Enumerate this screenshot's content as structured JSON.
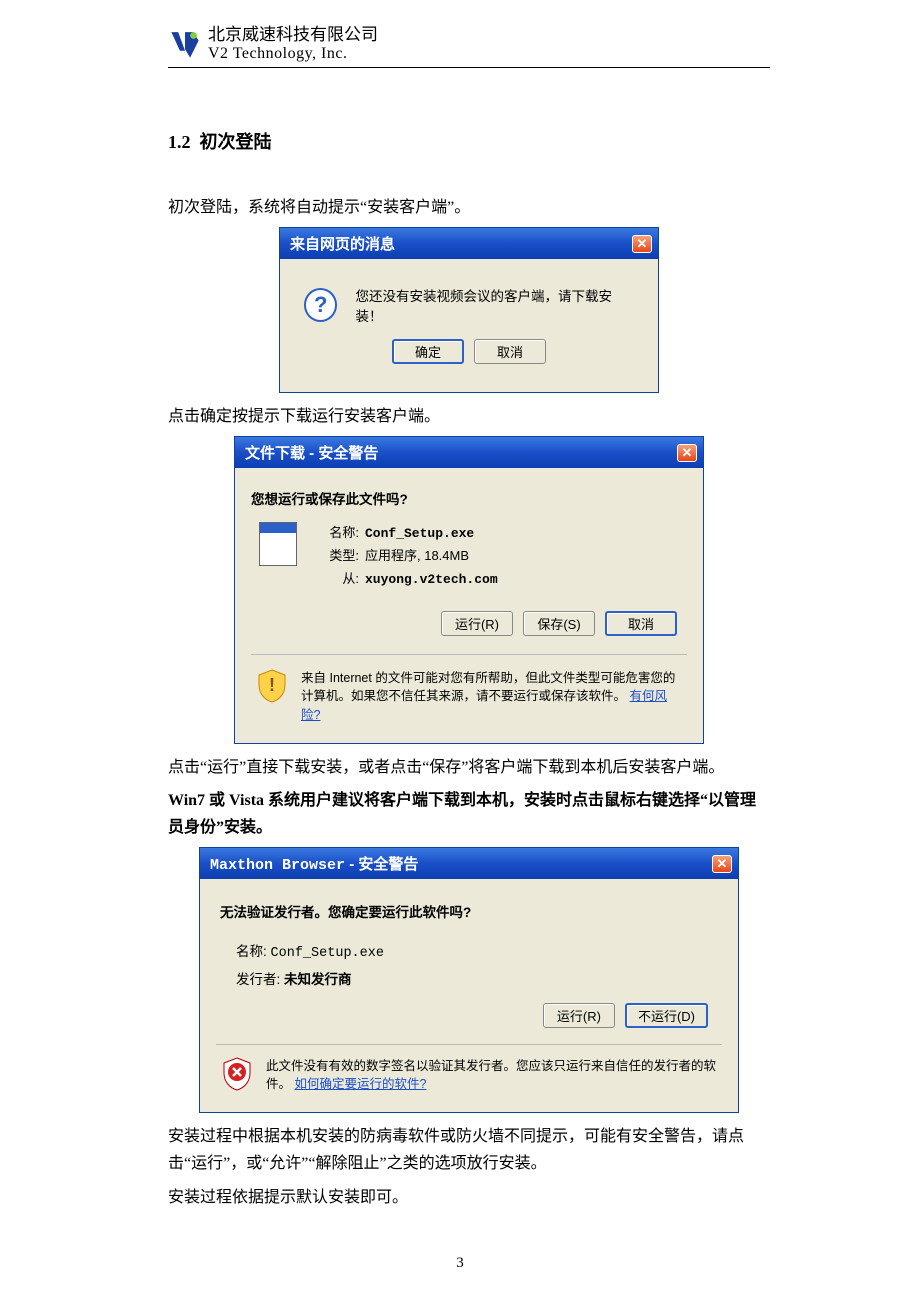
{
  "header": {
    "company_cn": "北京威速科技有限公司",
    "company_en": "V2 Technology, Inc.",
    "logo_text": "Technology"
  },
  "section": {
    "number": "1.2",
    "title": "初次登陆"
  },
  "paragraphs": {
    "p1": "初次登陆，系统将自动提示“安装客户端”。",
    "p2": "点击确定按提示下载运行安装客户端。",
    "p3": "点击“运行”直接下载安装，或者点击“保存”将客户端下载到本机后安装客户端。",
    "p3b": "Win7 或 Vista 系统用户建议将客户端下载到本机，安装时点击鼠标右键选择“以管理员身份”安装。",
    "p4": "安装过程中根据本机安装的防病毒软件或防火墙不同提示，可能有安全警告，请点击“运行”，或“允许”“解除阻止”之类的选项放行安装。",
    "p5": "安装过程依据提示默认安装即可。"
  },
  "dialog1": {
    "title": "来自网页的消息",
    "message": "您还没有安装视频会议的客户端，请下载安装！",
    "ok": "确定",
    "cancel": "取消"
  },
  "dialog2": {
    "title": "文件下载 - 安全警告",
    "question": "您想运行或保存此文件吗?",
    "name_k": "名称:",
    "name_v": "Conf_Setup.exe",
    "type_k": "类型:",
    "type_v": "应用程序, 18.4MB",
    "from_k": "从:",
    "from_v": "xuyong.v2tech.com",
    "run": "运行(R)",
    "save": "保存(S)",
    "cancel": "取消",
    "warn": "来自 Internet 的文件可能对您有所帮助，但此文件类型可能危害您的计算机。如果您不信任其来源，请不要运行或保存该软件。",
    "risk_link": "有何风险?"
  },
  "dialog3": {
    "title_app": "Maxthon Browser",
    "title_rest": " - 安全警告",
    "question": "无法验证发行者。您确定要运行此软件吗?",
    "name_k": "名称:",
    "name_v": "Conf_Setup.exe",
    "pub_k": "发行者:",
    "pub_v": "未知发行商",
    "run": "运行(R)",
    "norun": "不运行(D)",
    "warn": "此文件没有有效的数字签名以验证其发行者。您应该只运行来自信任的发行者的软件。",
    "how_link": "如何确定要运行的软件?"
  },
  "page_number": "3"
}
